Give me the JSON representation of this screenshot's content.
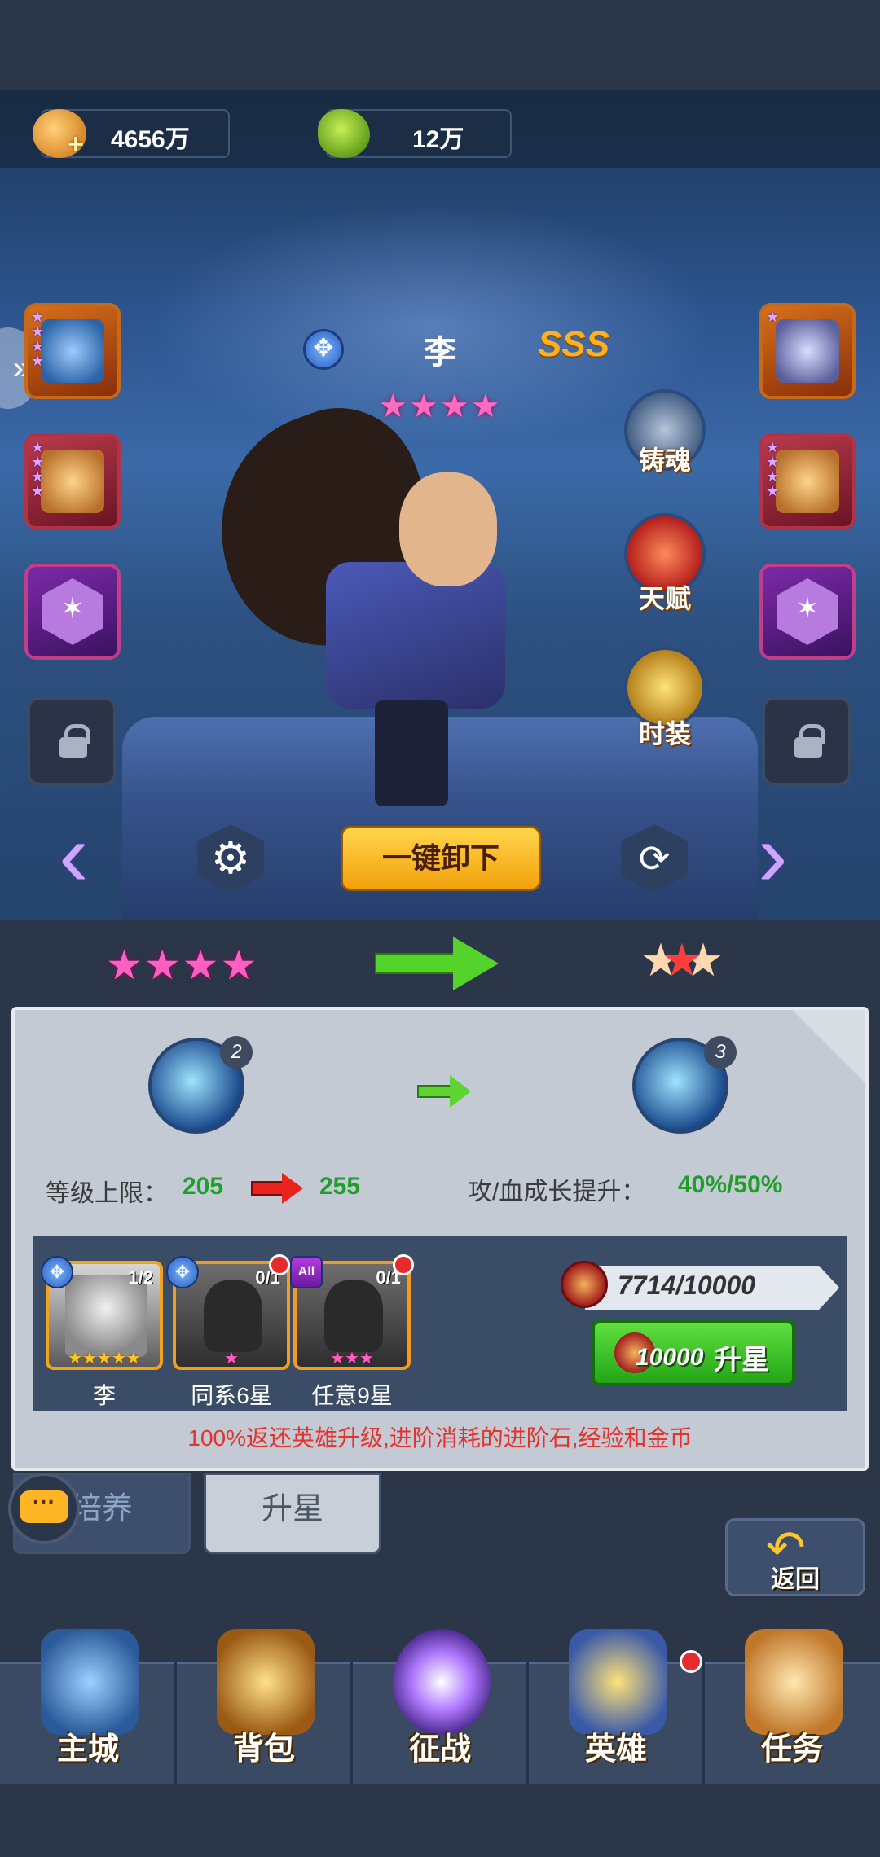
{
  "resources": {
    "gold": "4656万",
    "gems": "12万"
  },
  "equipment_slots": {
    "left": [
      {
        "icon": "weapon-crossbow-icon",
        "frame": "orange",
        "stars": 4
      },
      {
        "icon": "bracer-icon",
        "frame": "red",
        "stars": 4
      },
      {
        "icon": "rune-gem-icon",
        "frame": "purple"
      },
      {
        "icon": "lock-icon",
        "frame": "locked"
      }
    ],
    "right": [
      {
        "icon": "armor-chest-icon",
        "frame": "orange",
        "stars": 1
      },
      {
        "icon": "boots-icon",
        "frame": "red",
        "stars": 4
      },
      {
        "icon": "rune-gem-icon",
        "frame": "purple"
      },
      {
        "icon": "lock-icon",
        "frame": "locked"
      }
    ]
  },
  "hero": {
    "name": "李",
    "grade": "SSS",
    "stars": "★★★★",
    "class_icon": "water-class-icon"
  },
  "hero_actions": [
    {
      "label": "铸魂",
      "icon": "hammer-anvil-icon"
    },
    {
      "label": "天赋",
      "icon": "phoenix-icon"
    },
    {
      "label": "时装",
      "icon": "golden-helmet-icon"
    }
  ],
  "controls": {
    "unequip_all": "一键卸下",
    "settings_icon": "gear-icon",
    "swap_icon": "refresh-icon"
  },
  "star_upgrade": {
    "current_stars": "★★★★",
    "next_star": "★",
    "skill_level_current": "2",
    "skill_level_next": "3",
    "level_cap_label": "等级上限：",
    "level_cap_from": "205",
    "level_cap_to": "255",
    "growth_label": "攻/血成长提升：",
    "growth_value": "40%/50%",
    "materials": [
      {
        "name": "李",
        "count": "1/2",
        "badge": "✥",
        "stars": "★★★★★",
        "kind": "portrait"
      },
      {
        "name": "同系6星",
        "count": "0/1",
        "badge": "✥",
        "stars": "★",
        "kind": "helmet",
        "alert": true
      },
      {
        "name": "任意9星",
        "count": "0/1",
        "badge": "All",
        "stars": "★★★",
        "kind": "helmet",
        "alert": true
      }
    ],
    "token_progress": "7714/10000",
    "upstar_cost": "10000",
    "upstar_label": "升星",
    "refund_note": "100%返还英雄升级,进阶消耗的进阶石,经验和金币"
  },
  "tabs": [
    {
      "label": "培养",
      "active": false
    },
    {
      "label": "升星",
      "active": true
    }
  ],
  "back_label": "返回",
  "nav": [
    {
      "label": "主城",
      "icon": "castle-icon"
    },
    {
      "label": "背包",
      "icon": "treasure-chest-icon"
    },
    {
      "label": "征战",
      "icon": "dragon-portal-icon"
    },
    {
      "label": "英雄",
      "icon": "hero-helmet-icon",
      "alert": true
    },
    {
      "label": "任务",
      "icon": "scroll-icon"
    }
  ],
  "colors": {
    "background": "#2b3648",
    "accent_gold": "#ffd44a",
    "accent_green": "#23a518",
    "star_pink": "#ff5ec2",
    "note_red": "#e5322c"
  }
}
